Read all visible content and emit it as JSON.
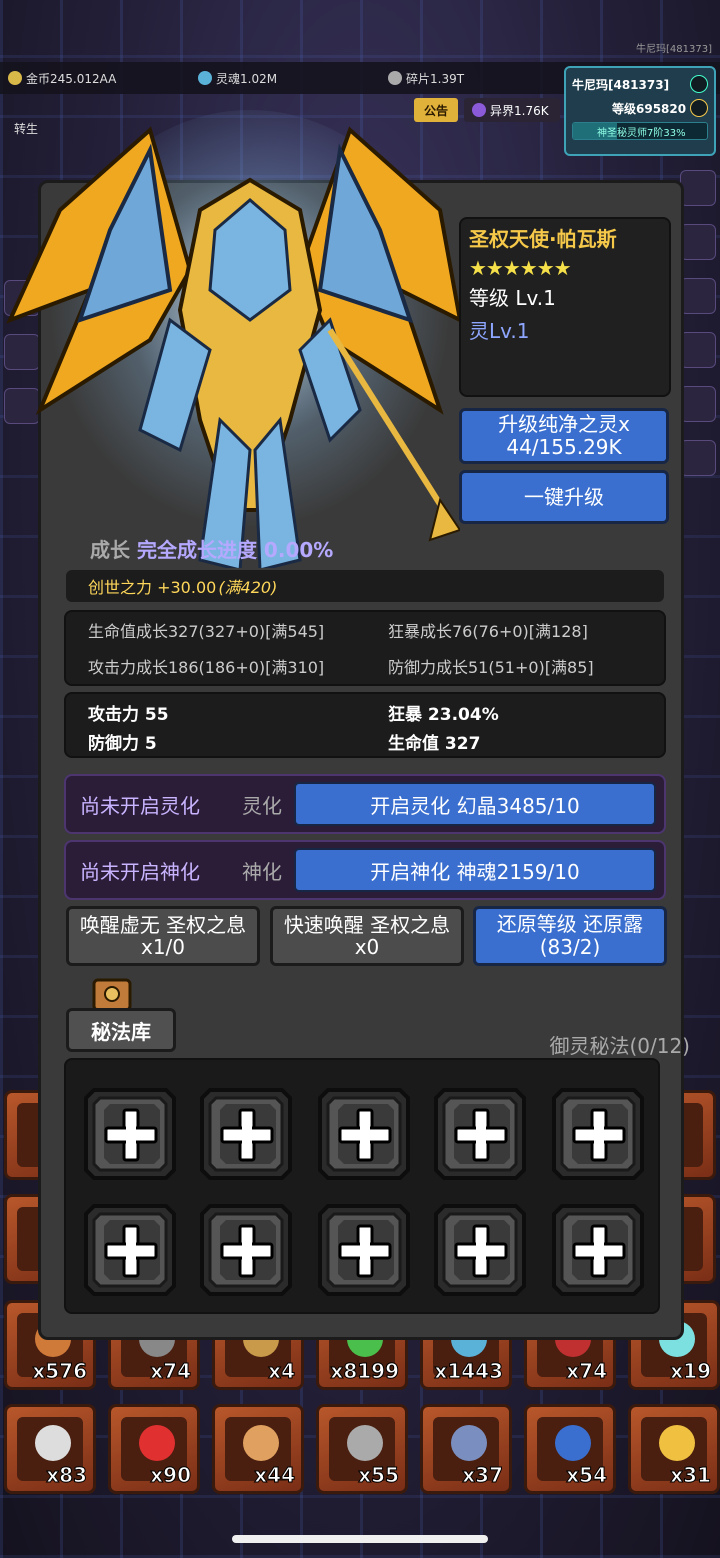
{
  "top_tag": "牛尼玛[481373]",
  "resources": [
    {
      "name": "gold",
      "label": "金币245.012AA",
      "color": "#d9b84a"
    },
    {
      "name": "soul",
      "label": "灵魂1.02M",
      "color": "#5ab2d9"
    },
    {
      "name": "shard",
      "label": "碎片1.39T",
      "color": "#aaaaaa"
    }
  ],
  "player": {
    "name": "牛尼玛[481373]",
    "level": "等级695820",
    "progress_text": "神圣秘灵师7阶33%",
    "progress_fraction": 0.33
  },
  "notice": "公告",
  "realm": "异界1.76K",
  "rebirth": "转生",
  "hero": {
    "name": "圣权天使·帕瓦斯",
    "stars": "★★★★★★",
    "level": "等级 Lv.1",
    "spirit_level": "灵Lv.1"
  },
  "buttons": {
    "upgrade": "升级纯净之灵x 44/155.29K",
    "one_click": "一键升级",
    "awaken_void": "唤醒虚无 圣权之息x1/0",
    "quick_awaken": "快速唤醒 圣权之息x0",
    "restore": "还原等级 还原露 (83/2)"
  },
  "growth": {
    "label": "成长",
    "value": "完全成长进度 0.00%"
  },
  "creation": {
    "text": "创世之力 +30.00",
    "max": "(满420)"
  },
  "growth_stats": [
    "生命值成长327(327+0)[满545]",
    "狂暴成长76(76+0)[满128]",
    "攻击力成长186(186+0)[满310]",
    "防御力成长51(51+0)[满85]"
  ],
  "stats": [
    "攻击力 55",
    "狂暴 23.04%",
    "防御力 5",
    "生命值 327"
  ],
  "spiritualize": {
    "state": "尚未开启灵化",
    "kind": "灵化",
    "button": "开启灵化 幻晶3485/10"
  },
  "deify": {
    "state": "尚未开启神化",
    "kind": "神化",
    "button": "开启神化 神魂2159/10"
  },
  "library": {
    "tab": "秘法库",
    "count": "御灵秘法(0/12)"
  },
  "inventory": {
    "row1": [
      "x576",
      "x74",
      "x4",
      "x8199",
      "x1443",
      "x74",
      "x19"
    ],
    "row2": [
      "x83",
      "x90",
      "x44",
      "x55",
      "x37",
      "x54",
      "x31"
    ]
  },
  "colors": {
    "accent_blue": "#3a6fcf",
    "gold_text": "#f5c84a",
    "spirit_text": "#8ea6ff",
    "panel": "#3a3a3a"
  }
}
